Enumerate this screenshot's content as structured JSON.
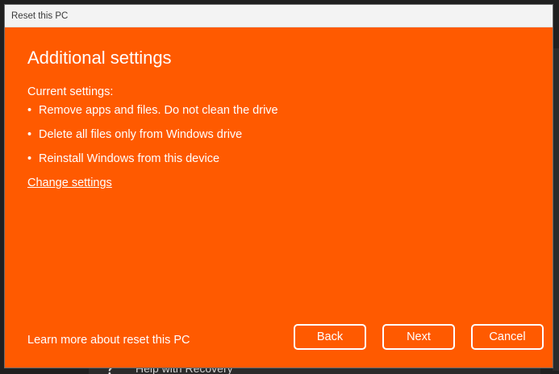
{
  "window": {
    "title": "Reset this PC"
  },
  "dialog": {
    "heading": "Additional settings",
    "current_settings_label": "Current settings:",
    "bullet_char": "•",
    "settings": [
      "Remove apps and files. Do not clean the drive",
      "Delete all files only from Windows drive",
      "Reinstall Windows from this device"
    ],
    "change_settings_link": "Change settings",
    "learn_more_link": "Learn more about reset this PC",
    "buttons": {
      "back": "Back",
      "next": "Next",
      "cancel": "Cancel"
    },
    "accent_color": "#ff5a00"
  },
  "background_window": {
    "partial_item_label": "Help with Recovery",
    "partial_item_icon": "help-icon"
  }
}
